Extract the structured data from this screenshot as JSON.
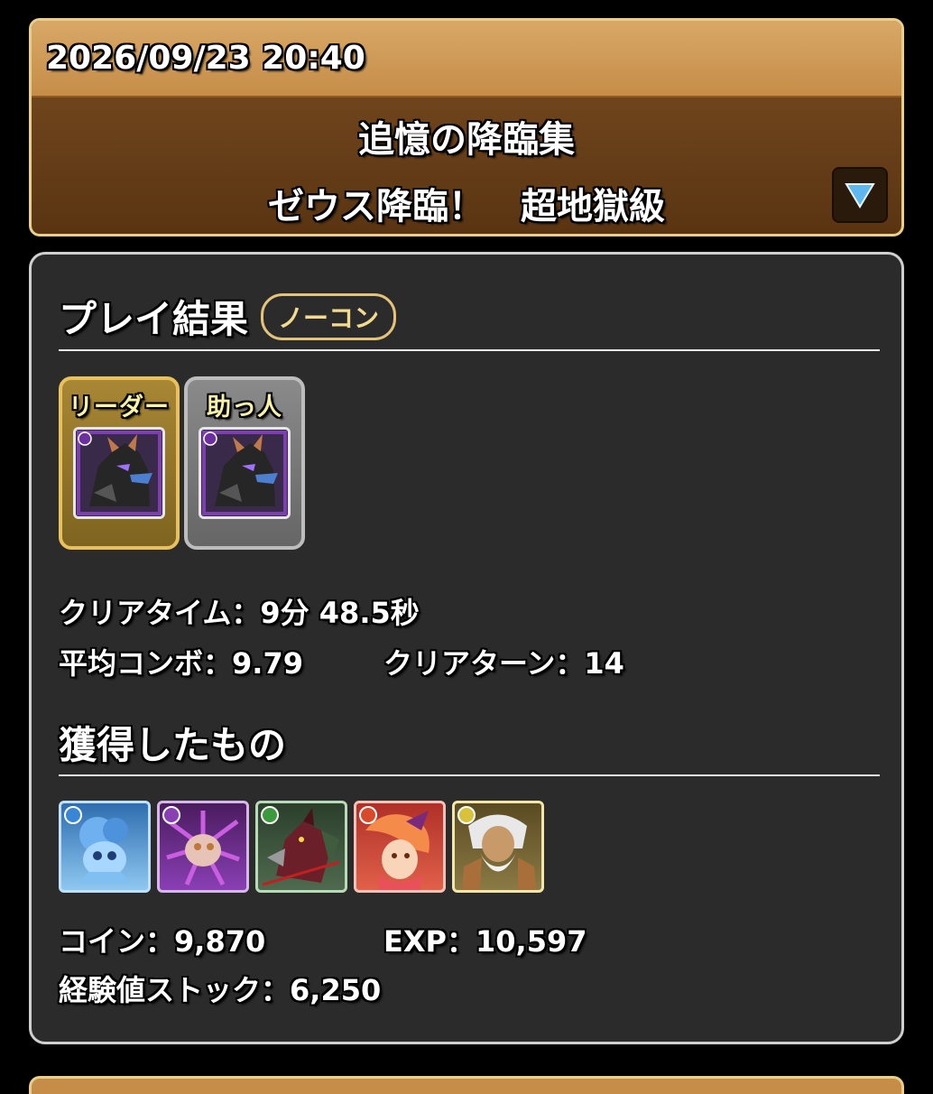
{
  "header": {
    "datetime": "2026/09/23 20:40",
    "title": "追憶の降臨集",
    "subtitle": "ゼウス降臨！　超地獄級",
    "toggle_icon": "triangle-down-icon"
  },
  "result": {
    "heading": "プレイ結果",
    "badge": "ノーコン",
    "leader_label": "リーダー",
    "helper_label": "助っ人",
    "clear_time_label": "クリアタイム：",
    "clear_time_value": "9分 48.5秒",
    "avg_combo_label": "平均コンボ：",
    "avg_combo_value": "9.79",
    "clear_turn_label": "クリアターン：",
    "clear_turn_value": "14"
  },
  "rewards": {
    "heading": "獲得したもの",
    "monsters": [
      {
        "attribute": "water",
        "color": "#3a86d6"
      },
      {
        "attribute": "dark",
        "color": "#8a3fb4"
      },
      {
        "attribute": "wood",
        "color": "#3c9a3c"
      },
      {
        "attribute": "fire",
        "color": "#d84a2a"
      },
      {
        "attribute": "light",
        "color": "#d8c23a"
      }
    ],
    "coin_label": "コイン：",
    "coin_value": "9,870",
    "exp_label": "EXP：",
    "exp_value": "10,597",
    "stock_label": "経験値ストック：",
    "stock_value": "6,250"
  }
}
